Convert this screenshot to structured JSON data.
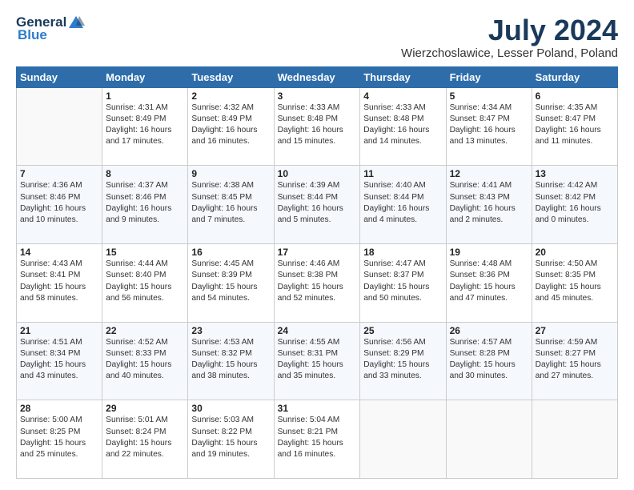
{
  "logo": {
    "general": "General",
    "blue": "Blue"
  },
  "header": {
    "month": "July 2024",
    "location": "Wierzchoslawice, Lesser Poland, Poland"
  },
  "weekdays": [
    "Sunday",
    "Monday",
    "Tuesday",
    "Wednesday",
    "Thursday",
    "Friday",
    "Saturday"
  ],
  "weeks": [
    [
      {
        "day": "",
        "info": ""
      },
      {
        "day": "1",
        "info": "Sunrise: 4:31 AM\nSunset: 8:49 PM\nDaylight: 16 hours\nand 17 minutes."
      },
      {
        "day": "2",
        "info": "Sunrise: 4:32 AM\nSunset: 8:49 PM\nDaylight: 16 hours\nand 16 minutes."
      },
      {
        "day": "3",
        "info": "Sunrise: 4:33 AM\nSunset: 8:48 PM\nDaylight: 16 hours\nand 15 minutes."
      },
      {
        "day": "4",
        "info": "Sunrise: 4:33 AM\nSunset: 8:48 PM\nDaylight: 16 hours\nand 14 minutes."
      },
      {
        "day": "5",
        "info": "Sunrise: 4:34 AM\nSunset: 8:47 PM\nDaylight: 16 hours\nand 13 minutes."
      },
      {
        "day": "6",
        "info": "Sunrise: 4:35 AM\nSunset: 8:47 PM\nDaylight: 16 hours\nand 11 minutes."
      }
    ],
    [
      {
        "day": "7",
        "info": "Sunrise: 4:36 AM\nSunset: 8:46 PM\nDaylight: 16 hours\nand 10 minutes."
      },
      {
        "day": "8",
        "info": "Sunrise: 4:37 AM\nSunset: 8:46 PM\nDaylight: 16 hours\nand 9 minutes."
      },
      {
        "day": "9",
        "info": "Sunrise: 4:38 AM\nSunset: 8:45 PM\nDaylight: 16 hours\nand 7 minutes."
      },
      {
        "day": "10",
        "info": "Sunrise: 4:39 AM\nSunset: 8:44 PM\nDaylight: 16 hours\nand 5 minutes."
      },
      {
        "day": "11",
        "info": "Sunrise: 4:40 AM\nSunset: 8:44 PM\nDaylight: 16 hours\nand 4 minutes."
      },
      {
        "day": "12",
        "info": "Sunrise: 4:41 AM\nSunset: 8:43 PM\nDaylight: 16 hours\nand 2 minutes."
      },
      {
        "day": "13",
        "info": "Sunrise: 4:42 AM\nSunset: 8:42 PM\nDaylight: 16 hours\nand 0 minutes."
      }
    ],
    [
      {
        "day": "14",
        "info": "Sunrise: 4:43 AM\nSunset: 8:41 PM\nDaylight: 15 hours\nand 58 minutes."
      },
      {
        "day": "15",
        "info": "Sunrise: 4:44 AM\nSunset: 8:40 PM\nDaylight: 15 hours\nand 56 minutes."
      },
      {
        "day": "16",
        "info": "Sunrise: 4:45 AM\nSunset: 8:39 PM\nDaylight: 15 hours\nand 54 minutes."
      },
      {
        "day": "17",
        "info": "Sunrise: 4:46 AM\nSunset: 8:38 PM\nDaylight: 15 hours\nand 52 minutes."
      },
      {
        "day": "18",
        "info": "Sunrise: 4:47 AM\nSunset: 8:37 PM\nDaylight: 15 hours\nand 50 minutes."
      },
      {
        "day": "19",
        "info": "Sunrise: 4:48 AM\nSunset: 8:36 PM\nDaylight: 15 hours\nand 47 minutes."
      },
      {
        "day": "20",
        "info": "Sunrise: 4:50 AM\nSunset: 8:35 PM\nDaylight: 15 hours\nand 45 minutes."
      }
    ],
    [
      {
        "day": "21",
        "info": "Sunrise: 4:51 AM\nSunset: 8:34 PM\nDaylight: 15 hours\nand 43 minutes."
      },
      {
        "day": "22",
        "info": "Sunrise: 4:52 AM\nSunset: 8:33 PM\nDaylight: 15 hours\nand 40 minutes."
      },
      {
        "day": "23",
        "info": "Sunrise: 4:53 AM\nSunset: 8:32 PM\nDaylight: 15 hours\nand 38 minutes."
      },
      {
        "day": "24",
        "info": "Sunrise: 4:55 AM\nSunset: 8:31 PM\nDaylight: 15 hours\nand 35 minutes."
      },
      {
        "day": "25",
        "info": "Sunrise: 4:56 AM\nSunset: 8:29 PM\nDaylight: 15 hours\nand 33 minutes."
      },
      {
        "day": "26",
        "info": "Sunrise: 4:57 AM\nSunset: 8:28 PM\nDaylight: 15 hours\nand 30 minutes."
      },
      {
        "day": "27",
        "info": "Sunrise: 4:59 AM\nSunset: 8:27 PM\nDaylight: 15 hours\nand 27 minutes."
      }
    ],
    [
      {
        "day": "28",
        "info": "Sunrise: 5:00 AM\nSunset: 8:25 PM\nDaylight: 15 hours\nand 25 minutes."
      },
      {
        "day": "29",
        "info": "Sunrise: 5:01 AM\nSunset: 8:24 PM\nDaylight: 15 hours\nand 22 minutes."
      },
      {
        "day": "30",
        "info": "Sunrise: 5:03 AM\nSunset: 8:22 PM\nDaylight: 15 hours\nand 19 minutes."
      },
      {
        "day": "31",
        "info": "Sunrise: 5:04 AM\nSunset: 8:21 PM\nDaylight: 15 hours\nand 16 minutes."
      },
      {
        "day": "",
        "info": ""
      },
      {
        "day": "",
        "info": ""
      },
      {
        "day": "",
        "info": ""
      }
    ]
  ]
}
